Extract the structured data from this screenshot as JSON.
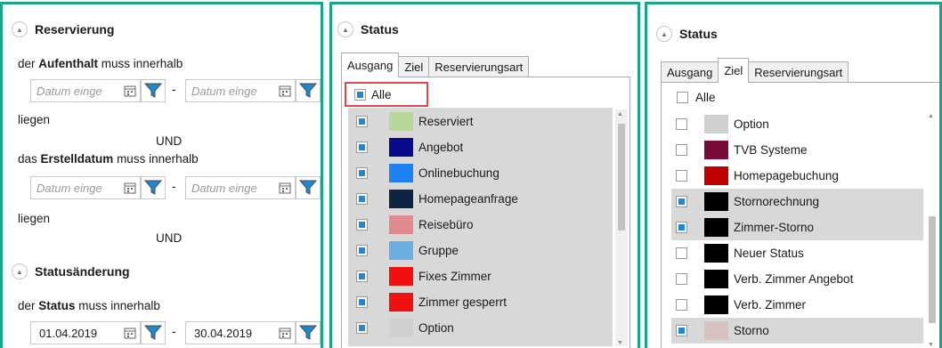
{
  "panel1": {
    "reservation": {
      "title": "Reservierung",
      "line1_pre": "der ",
      "line1_bold": "Aufenthalt",
      "line1_post": " muss innerhalb",
      "from_placeholder": "Datum einge",
      "to_placeholder": "Datum einge",
      "liegen": "liegen",
      "und": "UND",
      "line2_pre": "das ",
      "line2_bold": "Erstelldatum",
      "line2_post": " muss innerhalb",
      "from2_placeholder": "Datum einge",
      "to2_placeholder": "Datum einge",
      "liegen2": "liegen",
      "und2": "UND"
    },
    "status_change": {
      "title": "Statusänderung",
      "line_pre": "der ",
      "line_bold": "Status",
      "line_post": " muss innerhalb",
      "from": "01.04.2019",
      "to": "30.04.2019"
    },
    "dash": "-"
  },
  "panel2": {
    "title": "Status",
    "tabs": [
      "Ausgang",
      "Ziel",
      "Reservierungsart"
    ],
    "active_tab": "Ausgang",
    "all_label": "Alle",
    "all_checked": true,
    "highlight_color": "#e0474c",
    "items": [
      {
        "label": "Reserviert",
        "color": "#b8d69a",
        "checked": true
      },
      {
        "label": "Angebot",
        "color": "#0a0a8a",
        "checked": true
      },
      {
        "label": "Onlinebuchung",
        "color": "#1e82f0",
        "checked": true
      },
      {
        "label": "Homepageanfrage",
        "color": "#0e2342",
        "checked": true
      },
      {
        "label": "Reisebüro",
        "color": "#e08a90",
        "checked": true
      },
      {
        "label": "Gruppe",
        "color": "#6aaee0",
        "checked": true
      },
      {
        "label": "Fixes Zimmer",
        "color": "#f01010",
        "checked": true
      },
      {
        "label": "Zimmer gesperrt",
        "color": "#f01010",
        "checked": true
      },
      {
        "label": "Option",
        "color": "#d0d0d0",
        "checked": true
      }
    ]
  },
  "panel3": {
    "title": "Status",
    "tabs": [
      "Ausgang",
      "Ziel",
      "Reservierungsart"
    ],
    "active_tab": "Ziel",
    "all_label": "Alle",
    "all_checked": false,
    "items": [
      {
        "label": "Option",
        "color": "#d0d0d0",
        "checked": false,
        "selected": false
      },
      {
        "label": "TVB Systeme",
        "color": "#7a0a3a",
        "checked": false,
        "selected": false
      },
      {
        "label": "Homepagebuchung",
        "color": "#c00000",
        "checked": false,
        "selected": false
      },
      {
        "label": "Stornorechnung",
        "color": "#000000",
        "checked": true,
        "selected": true
      },
      {
        "label": "Zimmer-Storno",
        "color": "#000000",
        "checked": true,
        "selected": true
      },
      {
        "label": "Neuer Status",
        "color": "#000000",
        "checked": false,
        "selected": false
      },
      {
        "label": "Verb. Zimmer Angebot",
        "color": "#000000",
        "checked": false,
        "selected": false
      },
      {
        "label": "Verb. Zimmer",
        "color": "#000000",
        "checked": false,
        "selected": false
      },
      {
        "label": "Storno",
        "color": "#d8bfc0",
        "checked": true,
        "selected": true
      }
    ]
  },
  "colors": {
    "panel_border": "#1aa58a",
    "selected_row": "#d8d8d8",
    "check_fill": "#1e88d2",
    "filter_icon": "#1e88d2"
  }
}
